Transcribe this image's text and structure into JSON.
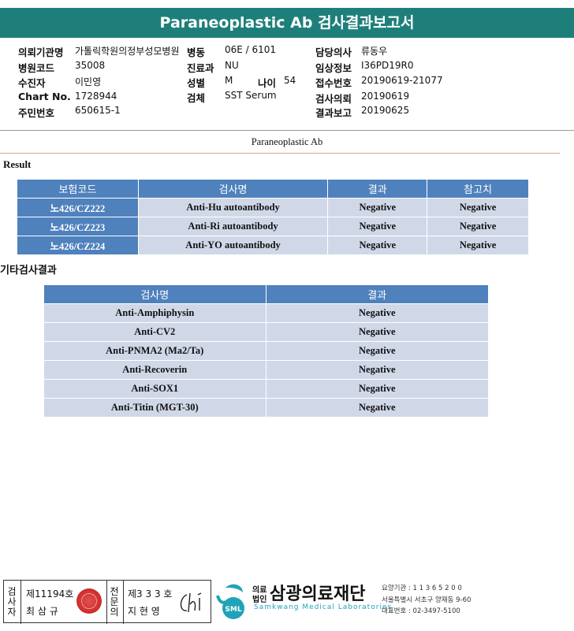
{
  "header": {
    "title": "Paraneoplastic Ab 검사결과보고서"
  },
  "patient": {
    "hospital_label": "의뢰기관명",
    "hospital": "가톨릭학원의정부성모병원",
    "ward_label": "병동",
    "ward": "06E / 6101",
    "doctor_label": "담당의사",
    "doctor": "류동우",
    "code_label": "병원코드",
    "code": "35008",
    "dept_label": "진료과",
    "dept": "NU",
    "clinical_label": "임상정보",
    "clinical": "I36PD19R0",
    "name_label": "수진자",
    "name": "이민영",
    "sex_label": "성별",
    "sex": "M",
    "age_label": "나이",
    "age": "54",
    "accession_label": "접수번호",
    "accession": "20190619-21077",
    "chart_label": "Chart No.",
    "chart": "1728944",
    "specimen_label": "검체",
    "specimen": "SST Serum",
    "request_label": "검사의뢰",
    "request_date": "20190619",
    "rrn_label": "주민번호",
    "rrn": "650615-1",
    "report_label": "결과보고",
    "report_date": "20190625"
  },
  "section": {
    "title": "Paraneoplastic Ab",
    "result_label": "Result",
    "other_label": "기타검사결과"
  },
  "table1": {
    "headers": [
      "보험코드",
      "검사명",
      "결과",
      "참고치"
    ],
    "rows": [
      [
        "노426/CZ222",
        "Anti-Hu autoantibody",
        "Negative",
        "Negative"
      ],
      [
        "노426/CZ223",
        "Anti-Ri autoantibody",
        "Negative",
        "Negative"
      ],
      [
        "노426/CZ224",
        "Anti-YO autoantibody",
        "Negative",
        "Negative"
      ]
    ]
  },
  "table2": {
    "headers": [
      "검사명",
      "결과"
    ],
    "rows": [
      [
        "Anti-Amphiphysin",
        "Negative"
      ],
      [
        "Anti-CV2",
        "Negative"
      ],
      [
        "Anti-PNMA2 (Ma2/Ta)",
        "Negative"
      ],
      [
        "Anti-Recoverin",
        "Negative"
      ],
      [
        "Anti-SOX1",
        "Negative"
      ],
      [
        "Anti-Titin (MGT-30)",
        "Negative"
      ]
    ]
  },
  "footer": {
    "examiner_label": [
      "검",
      "사",
      "자"
    ],
    "examiner_license": "제11194호",
    "examiner_name": "최 삼 규",
    "specialist_label": [
      "전",
      "문",
      "의"
    ],
    "specialist_license": "제3 3 3 호",
    "specialist_name": "지 현 영",
    "org_small_1": "의료",
    "org_small_2": "법인",
    "org_name": "삼광의료재단",
    "org_english": "Samkwang Medical Laboratories",
    "logo_text": "SML",
    "org_id": "요양기관 : 1 1 3 6 5 2 0 0",
    "org_address": "서울특별시 서초구 양재동 9-60",
    "org_phone": "대표번호 : 02-3497-5100",
    "colors": {
      "teal": "#1e7f7a",
      "header_blue": "#4f81bd",
      "row_blue": "#d0d8e8",
      "logo_cyan": "#1fa3b8",
      "seal_red": "#d23030"
    }
  }
}
